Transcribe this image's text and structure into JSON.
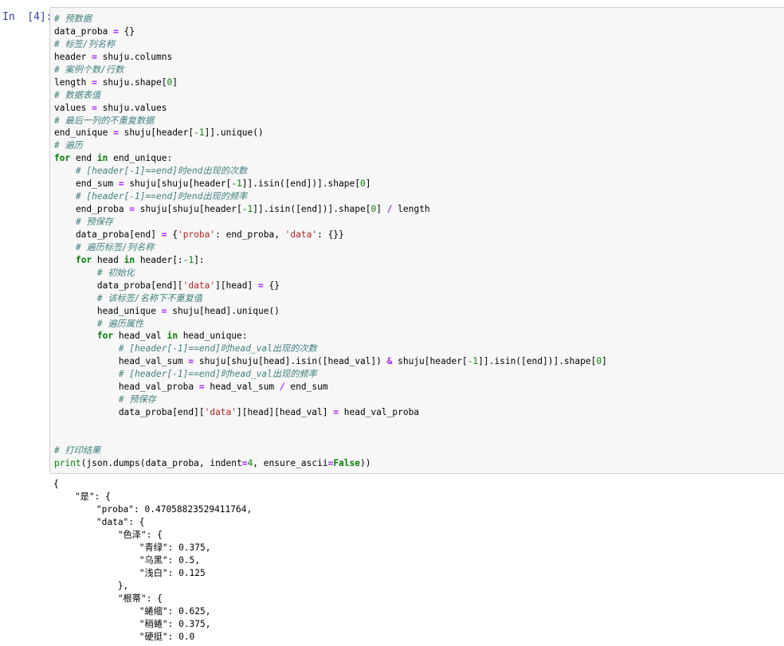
{
  "cell": {
    "prompt": "In  [4]:",
    "code_lines": [
      [
        {
          "t": "# 预数据",
          "c": "c"
        }
      ],
      [
        {
          "t": "data_proba ",
          "c": "t"
        },
        {
          "t": "=",
          "c": "o"
        },
        {
          "t": " {}",
          "c": "t"
        }
      ],
      [
        {
          "t": "# 标签/列名称",
          "c": "c"
        }
      ],
      [
        {
          "t": "header ",
          "c": "t"
        },
        {
          "t": "=",
          "c": "o"
        },
        {
          "t": " shuju.columns",
          "c": "t"
        }
      ],
      [
        {
          "t": "# 案例个数/行数",
          "c": "c"
        }
      ],
      [
        {
          "t": "length ",
          "c": "t"
        },
        {
          "t": "=",
          "c": "o"
        },
        {
          "t": " shuju.shape[",
          "c": "t"
        },
        {
          "t": "0",
          "c": "n"
        },
        {
          "t": "]",
          "c": "t"
        }
      ],
      [
        {
          "t": "# 数据表值",
          "c": "c"
        }
      ],
      [
        {
          "t": "values ",
          "c": "t"
        },
        {
          "t": "=",
          "c": "o"
        },
        {
          "t": " shuju.values",
          "c": "t"
        }
      ],
      [
        {
          "t": "# 最后一列的不重复数据",
          "c": "c"
        }
      ],
      [
        {
          "t": "end_unique ",
          "c": "t"
        },
        {
          "t": "=",
          "c": "o"
        },
        {
          "t": " shuju[header[",
          "c": "t"
        },
        {
          "t": "-1",
          "c": "n"
        },
        {
          "t": "]].unique()",
          "c": "t"
        }
      ],
      [
        {
          "t": "# 遍历",
          "c": "c"
        }
      ],
      [
        {
          "t": "for",
          "c": "k"
        },
        {
          "t": " end ",
          "c": "t"
        },
        {
          "t": "in",
          "c": "k"
        },
        {
          "t": " end_unique:",
          "c": "t"
        }
      ],
      [
        {
          "t": "    ",
          "c": "t"
        },
        {
          "t": "# [header[-1]==end]时end出现的次数",
          "c": "c"
        }
      ],
      [
        {
          "t": "    end_sum ",
          "c": "t"
        },
        {
          "t": "=",
          "c": "o"
        },
        {
          "t": " shuju[shuju[header[",
          "c": "t"
        },
        {
          "t": "-1",
          "c": "n"
        },
        {
          "t": "]].isin([end])].shape[",
          "c": "t"
        },
        {
          "t": "0",
          "c": "n"
        },
        {
          "t": "]",
          "c": "t"
        }
      ],
      [
        {
          "t": "    ",
          "c": "t"
        },
        {
          "t": "# [header[-1]==end]时end出现的频率",
          "c": "c"
        }
      ],
      [
        {
          "t": "    end_proba ",
          "c": "t"
        },
        {
          "t": "=",
          "c": "o"
        },
        {
          "t": " shuju[shuju[header[",
          "c": "t"
        },
        {
          "t": "-1",
          "c": "n"
        },
        {
          "t": "]].isin([end])].shape[",
          "c": "t"
        },
        {
          "t": "0",
          "c": "n"
        },
        {
          "t": "] ",
          "c": "t"
        },
        {
          "t": "/",
          "c": "o"
        },
        {
          "t": " length",
          "c": "t"
        }
      ],
      [
        {
          "t": "    ",
          "c": "t"
        },
        {
          "t": "# 预保存",
          "c": "c"
        }
      ],
      [
        {
          "t": "    data_proba[end] ",
          "c": "t"
        },
        {
          "t": "=",
          "c": "o"
        },
        {
          "t": " {",
          "c": "t"
        },
        {
          "t": "'proba'",
          "c": "s"
        },
        {
          "t": ": end_proba, ",
          "c": "t"
        },
        {
          "t": "'data'",
          "c": "s"
        },
        {
          "t": ": {}}",
          "c": "t"
        }
      ],
      [
        {
          "t": "    ",
          "c": "t"
        },
        {
          "t": "# 遍历标签/列名称",
          "c": "c"
        }
      ],
      [
        {
          "t": "    ",
          "c": "t"
        },
        {
          "t": "for",
          "c": "k"
        },
        {
          "t": " head ",
          "c": "t"
        },
        {
          "t": "in",
          "c": "k"
        },
        {
          "t": " header[:",
          "c": "t"
        },
        {
          "t": "-1",
          "c": "n"
        },
        {
          "t": "]:",
          "c": "t"
        }
      ],
      [
        {
          "t": "        ",
          "c": "t"
        },
        {
          "t": "# 初始化",
          "c": "c"
        }
      ],
      [
        {
          "t": "        data_proba[end][",
          "c": "t"
        },
        {
          "t": "'data'",
          "c": "s"
        },
        {
          "t": "][head] ",
          "c": "t"
        },
        {
          "t": "=",
          "c": "o"
        },
        {
          "t": " {}",
          "c": "t"
        }
      ],
      [
        {
          "t": "        ",
          "c": "t"
        },
        {
          "t": "# 该标签/名称下不重复值",
          "c": "c"
        }
      ],
      [
        {
          "t": "        head_unique ",
          "c": "t"
        },
        {
          "t": "=",
          "c": "o"
        },
        {
          "t": " shuju[head].unique()",
          "c": "t"
        }
      ],
      [
        {
          "t": "        ",
          "c": "t"
        },
        {
          "t": "# 遍历属性",
          "c": "c"
        }
      ],
      [
        {
          "t": "        ",
          "c": "t"
        },
        {
          "t": "for",
          "c": "k"
        },
        {
          "t": " head_val ",
          "c": "t"
        },
        {
          "t": "in",
          "c": "k"
        },
        {
          "t": " head_unique:",
          "c": "t"
        }
      ],
      [
        {
          "t": "            ",
          "c": "t"
        },
        {
          "t": "# [header[-1]==end]时head_val出现的次数",
          "c": "c"
        }
      ],
      [
        {
          "t": "            head_val_sum ",
          "c": "t"
        },
        {
          "t": "=",
          "c": "o"
        },
        {
          "t": " shuju[shuju[head].isin([head_val]) ",
          "c": "t"
        },
        {
          "t": "&",
          "c": "o"
        },
        {
          "t": " shuju[header[",
          "c": "t"
        },
        {
          "t": "-1",
          "c": "n"
        },
        {
          "t": "]].isin([end])].shape[",
          "c": "t"
        },
        {
          "t": "0",
          "c": "n"
        },
        {
          "t": "]",
          "c": "t"
        }
      ],
      [
        {
          "t": "            ",
          "c": "t"
        },
        {
          "t": "# [header[-1]==end]时head_val出现的频率",
          "c": "c"
        }
      ],
      [
        {
          "t": "            head_val_proba ",
          "c": "t"
        },
        {
          "t": "=",
          "c": "o"
        },
        {
          "t": " head_val_sum ",
          "c": "t"
        },
        {
          "t": "/",
          "c": "o"
        },
        {
          "t": " end_sum",
          "c": "t"
        }
      ],
      [
        {
          "t": "            ",
          "c": "t"
        },
        {
          "t": "# 预保存",
          "c": "c"
        }
      ],
      [
        {
          "t": "            data_proba[end][",
          "c": "t"
        },
        {
          "t": "'data'",
          "c": "s"
        },
        {
          "t": "][head][head_val] ",
          "c": "t"
        },
        {
          "t": "=",
          "c": "o"
        },
        {
          "t": " head_val_proba",
          "c": "t"
        }
      ],
      [],
      [],
      [
        {
          "t": "# 打印结果",
          "c": "c"
        }
      ],
      [
        {
          "t": "print",
          "c": "n"
        },
        {
          "t": "(json.dumps(data_proba, indent",
          "c": "t"
        },
        {
          "t": "=",
          "c": "o"
        },
        {
          "t": "4",
          "c": "n"
        },
        {
          "t": ", ensure_ascii",
          "c": "t"
        },
        {
          "t": "=",
          "c": "o"
        },
        {
          "t": "False",
          "c": "k"
        },
        {
          "t": "))",
          "c": "t"
        }
      ]
    ]
  },
  "output": {
    "lines": [
      "{",
      "    \"是\": {",
      "        \"proba\": 0.47058823529411764,",
      "        \"data\": {",
      "            \"色泽\": {",
      "                \"青绿\": 0.375,",
      "                \"乌黑\": 0.5,",
      "                \"浅白\": 0.125",
      "            },",
      "            \"根蒂\": {",
      "                \"蜷缩\": 0.625,",
      "                \"稍蜷\": 0.375,",
      "                \"硬挺\": 0.0"
    ]
  }
}
